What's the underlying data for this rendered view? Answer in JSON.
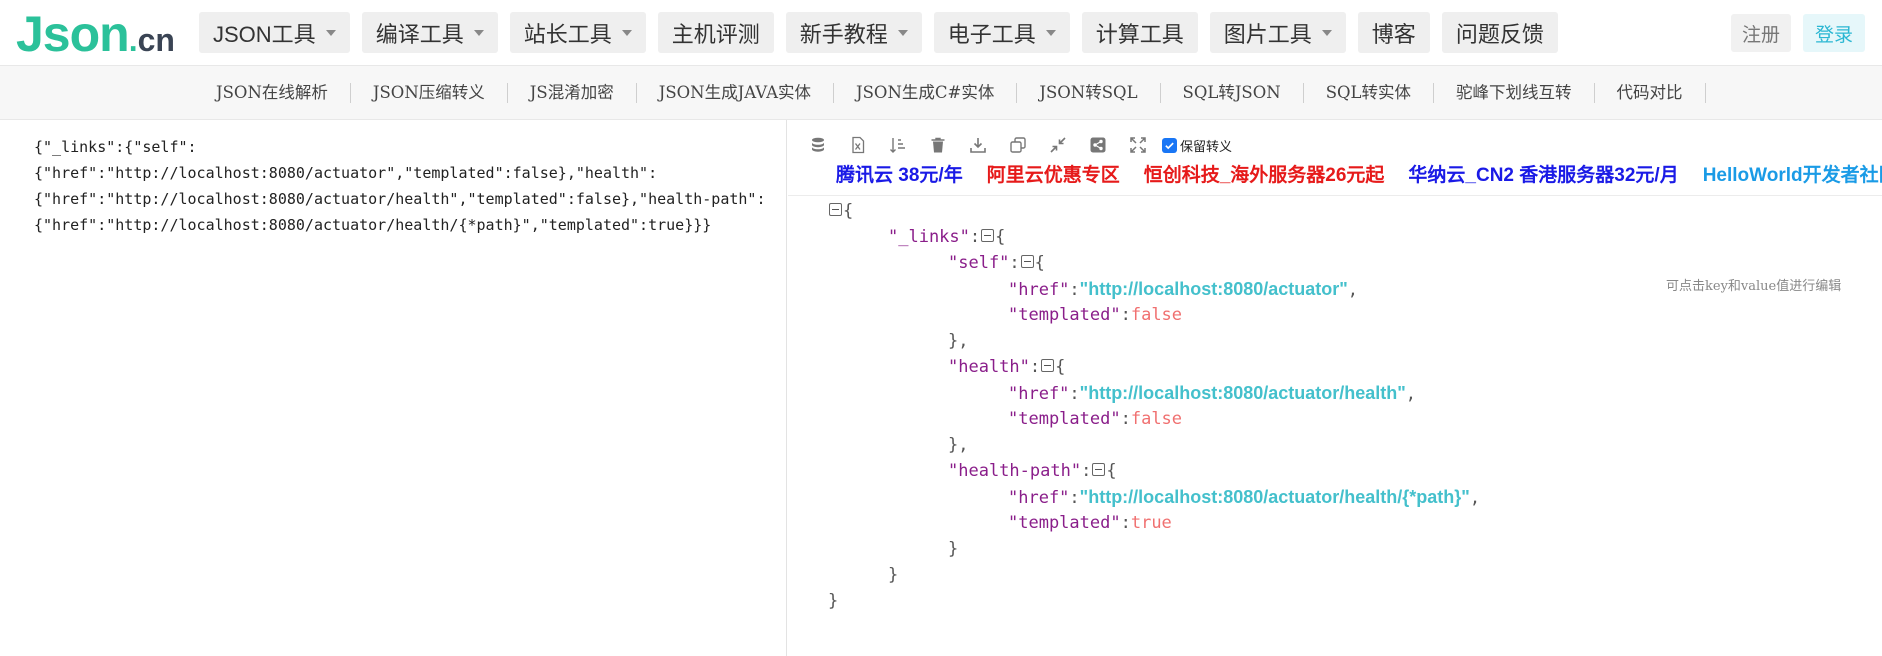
{
  "logo": {
    "main": "Json",
    "dot": ".",
    "suffix": "cn"
  },
  "nav": [
    {
      "label": "JSON工具",
      "dropdown": true
    },
    {
      "label": "编译工具",
      "dropdown": true
    },
    {
      "label": "站长工具",
      "dropdown": true
    },
    {
      "label": "主机评测",
      "dropdown": false
    },
    {
      "label": "新手教程",
      "dropdown": true
    },
    {
      "label": "电子工具",
      "dropdown": true
    },
    {
      "label": "计算工具",
      "dropdown": false
    },
    {
      "label": "图片工具",
      "dropdown": true
    },
    {
      "label": "博客",
      "dropdown": false
    },
    {
      "label": "问题反馈",
      "dropdown": false
    }
  ],
  "auth": {
    "register": "注册",
    "login": "登录"
  },
  "subnav": [
    "JSON在线解析",
    "JSON压缩转义",
    "JS混淆加密",
    "JSON生成JAVA实体",
    "JSON生成C#实体",
    "JSON转SQL",
    "SQL转JSON",
    "SQL转实体",
    "驼峰下划线互转",
    "代码对比"
  ],
  "editor": {
    "raw_lines": [
      "{\"_links\":{\"self\":",
      "{\"href\":\"http://localhost:8080/actuator\",\"templated\":false},\"health\":",
      "{\"href\":\"http://localhost:8080/actuator/health\",\"templated\":false},\"health-path\":",
      "{\"href\":\"http://localhost:8080/actuator/health/{*path}\",\"templated\":true}}}"
    ]
  },
  "toolbar": {
    "icons": [
      "database-icon",
      "excel-icon",
      "sort-icon",
      "trash-icon",
      "download-icon",
      "copy-icon",
      "compress-icon",
      "share-icon",
      "fullscreen-icon"
    ],
    "keep_escape_label": "保留转义",
    "keep_escape_checked": true
  },
  "ads": [
    {
      "text": "腾讯云 38元/年",
      "color": "#1a1ae6"
    },
    {
      "text": "阿里云优惠专区",
      "color": "#e61a1a"
    },
    {
      "text": "恒创科技_海外服务器26元起",
      "color": "#e61a1a"
    },
    {
      "text": "华纳云_CN2 香港服务器32元/月",
      "color": "#1a1ae6"
    },
    {
      "text": "HelloWorld开发者社区",
      "color": "#1a9be6"
    }
  ],
  "tree": {
    "keys": {
      "links": "\"_links\"",
      "self": "\"self\"",
      "health": "\"health\"",
      "health_path": "\"health-path\"",
      "href": "\"href\"",
      "templated": "\"templated\""
    },
    "values": {
      "self_href": "\"http://localhost:8080/actuator\"",
      "self_templated": "false",
      "health_href": "\"http://localhost:8080/actuator/health\"",
      "health_templated": "false",
      "health_path_href": "\"http://localhost:8080/actuator/health/{*path}\"",
      "health_path_templated": "true"
    }
  },
  "hint": "可点击key和value值进行编辑"
}
